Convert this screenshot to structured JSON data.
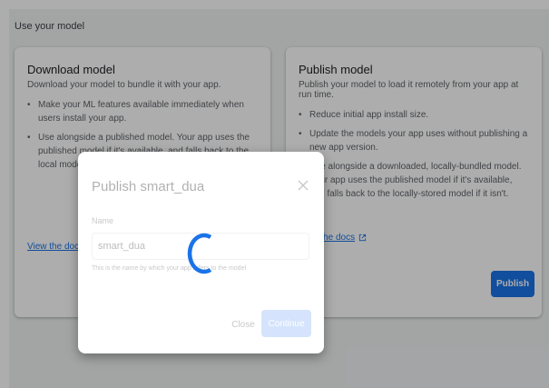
{
  "section_title": "Use your model",
  "download": {
    "title": "Download model",
    "description": "Download your model to bundle it with your app.",
    "bullets": [
      "Make your ML features available immediately when users install your app.",
      "Use alongside a published model. Your app uses the published model if it's available, and falls back to the local model if it isn't."
    ],
    "docs_link": "View the docs"
  },
  "publish": {
    "title": "Publish model",
    "description": "Publish your model to load it remotely from your app at run time.",
    "bullets": [
      "Reduce initial app install size.",
      "Update the models your app uses without publishing a new app version.",
      "Use alongside a downloaded, locally-bundled model. Your app uses the published model if it's available, and falls back to the locally-stored model if it isn't."
    ],
    "docs_link": "View the docs",
    "button": "Publish"
  },
  "dialog": {
    "title": "Publish smart_dua",
    "field_label": "Name",
    "name_value": "smart_dua",
    "hint": "This is the name by which your app refers to the model",
    "close_label": "Close",
    "continue_label": "Continue"
  },
  "colors": {
    "accent": "#1a73e8",
    "scrim": "rgba(0,0,0,0.32)"
  }
}
